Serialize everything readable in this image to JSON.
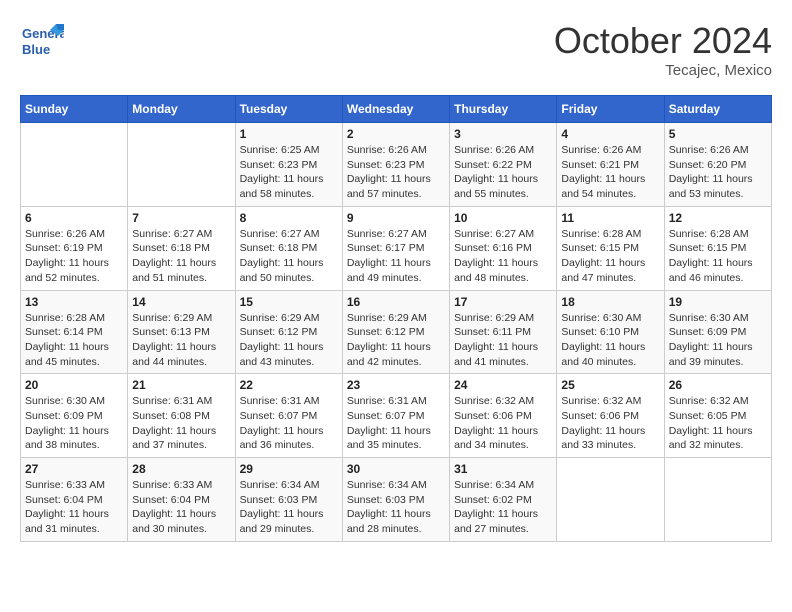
{
  "header": {
    "logo_line1": "General",
    "logo_line2": "Blue",
    "month_title": "October 2024",
    "location": "Tecajec, Mexico"
  },
  "days_of_week": [
    "Sunday",
    "Monday",
    "Tuesday",
    "Wednesday",
    "Thursday",
    "Friday",
    "Saturday"
  ],
  "weeks": [
    [
      {
        "day": "",
        "info": ""
      },
      {
        "day": "",
        "info": ""
      },
      {
        "day": "1",
        "info": "Sunrise: 6:25 AM\nSunset: 6:23 PM\nDaylight: 11 hours and 58 minutes."
      },
      {
        "day": "2",
        "info": "Sunrise: 6:26 AM\nSunset: 6:23 PM\nDaylight: 11 hours and 57 minutes."
      },
      {
        "day": "3",
        "info": "Sunrise: 6:26 AM\nSunset: 6:22 PM\nDaylight: 11 hours and 55 minutes."
      },
      {
        "day": "4",
        "info": "Sunrise: 6:26 AM\nSunset: 6:21 PM\nDaylight: 11 hours and 54 minutes."
      },
      {
        "day": "5",
        "info": "Sunrise: 6:26 AM\nSunset: 6:20 PM\nDaylight: 11 hours and 53 minutes."
      }
    ],
    [
      {
        "day": "6",
        "info": "Sunrise: 6:26 AM\nSunset: 6:19 PM\nDaylight: 11 hours and 52 minutes."
      },
      {
        "day": "7",
        "info": "Sunrise: 6:27 AM\nSunset: 6:18 PM\nDaylight: 11 hours and 51 minutes."
      },
      {
        "day": "8",
        "info": "Sunrise: 6:27 AM\nSunset: 6:18 PM\nDaylight: 11 hours and 50 minutes."
      },
      {
        "day": "9",
        "info": "Sunrise: 6:27 AM\nSunset: 6:17 PM\nDaylight: 11 hours and 49 minutes."
      },
      {
        "day": "10",
        "info": "Sunrise: 6:27 AM\nSunset: 6:16 PM\nDaylight: 11 hours and 48 minutes."
      },
      {
        "day": "11",
        "info": "Sunrise: 6:28 AM\nSunset: 6:15 PM\nDaylight: 11 hours and 47 minutes."
      },
      {
        "day": "12",
        "info": "Sunrise: 6:28 AM\nSunset: 6:15 PM\nDaylight: 11 hours and 46 minutes."
      }
    ],
    [
      {
        "day": "13",
        "info": "Sunrise: 6:28 AM\nSunset: 6:14 PM\nDaylight: 11 hours and 45 minutes."
      },
      {
        "day": "14",
        "info": "Sunrise: 6:29 AM\nSunset: 6:13 PM\nDaylight: 11 hours and 44 minutes."
      },
      {
        "day": "15",
        "info": "Sunrise: 6:29 AM\nSunset: 6:12 PM\nDaylight: 11 hours and 43 minutes."
      },
      {
        "day": "16",
        "info": "Sunrise: 6:29 AM\nSunset: 6:12 PM\nDaylight: 11 hours and 42 minutes."
      },
      {
        "day": "17",
        "info": "Sunrise: 6:29 AM\nSunset: 6:11 PM\nDaylight: 11 hours and 41 minutes."
      },
      {
        "day": "18",
        "info": "Sunrise: 6:30 AM\nSunset: 6:10 PM\nDaylight: 11 hours and 40 minutes."
      },
      {
        "day": "19",
        "info": "Sunrise: 6:30 AM\nSunset: 6:09 PM\nDaylight: 11 hours and 39 minutes."
      }
    ],
    [
      {
        "day": "20",
        "info": "Sunrise: 6:30 AM\nSunset: 6:09 PM\nDaylight: 11 hours and 38 minutes."
      },
      {
        "day": "21",
        "info": "Sunrise: 6:31 AM\nSunset: 6:08 PM\nDaylight: 11 hours and 37 minutes."
      },
      {
        "day": "22",
        "info": "Sunrise: 6:31 AM\nSunset: 6:07 PM\nDaylight: 11 hours and 36 minutes."
      },
      {
        "day": "23",
        "info": "Sunrise: 6:31 AM\nSunset: 6:07 PM\nDaylight: 11 hours and 35 minutes."
      },
      {
        "day": "24",
        "info": "Sunrise: 6:32 AM\nSunset: 6:06 PM\nDaylight: 11 hours and 34 minutes."
      },
      {
        "day": "25",
        "info": "Sunrise: 6:32 AM\nSunset: 6:06 PM\nDaylight: 11 hours and 33 minutes."
      },
      {
        "day": "26",
        "info": "Sunrise: 6:32 AM\nSunset: 6:05 PM\nDaylight: 11 hours and 32 minutes."
      }
    ],
    [
      {
        "day": "27",
        "info": "Sunrise: 6:33 AM\nSunset: 6:04 PM\nDaylight: 11 hours and 31 minutes."
      },
      {
        "day": "28",
        "info": "Sunrise: 6:33 AM\nSunset: 6:04 PM\nDaylight: 11 hours and 30 minutes."
      },
      {
        "day": "29",
        "info": "Sunrise: 6:34 AM\nSunset: 6:03 PM\nDaylight: 11 hours and 29 minutes."
      },
      {
        "day": "30",
        "info": "Sunrise: 6:34 AM\nSunset: 6:03 PM\nDaylight: 11 hours and 28 minutes."
      },
      {
        "day": "31",
        "info": "Sunrise: 6:34 AM\nSunset: 6:02 PM\nDaylight: 11 hours and 27 minutes."
      },
      {
        "day": "",
        "info": ""
      },
      {
        "day": "",
        "info": ""
      }
    ]
  ]
}
